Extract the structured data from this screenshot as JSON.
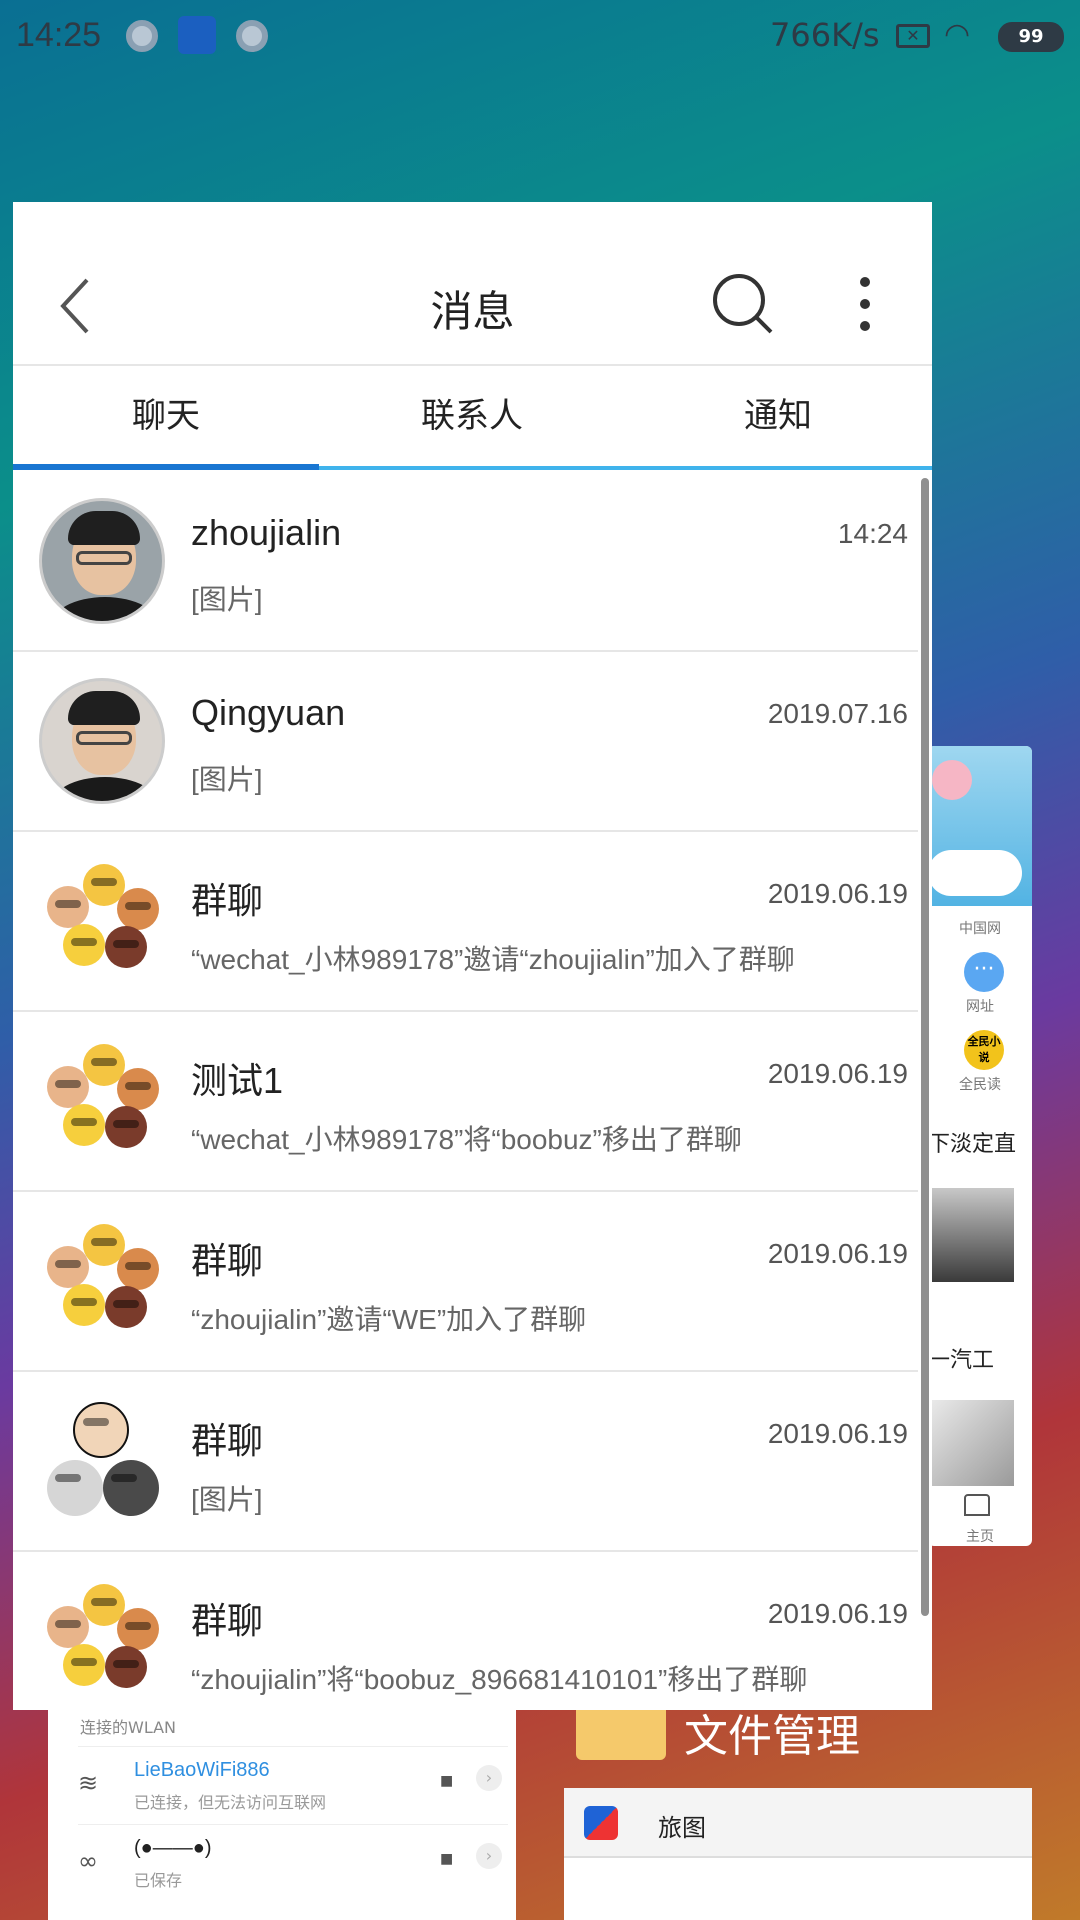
{
  "status_bar": {
    "time": "14:25",
    "speed": "766K/s",
    "battery": "99"
  },
  "app": {
    "title": "消息",
    "tabs": [
      {
        "label": "聊天",
        "active": true
      },
      {
        "label": "联系人",
        "active": false
      },
      {
        "label": "通知",
        "active": false
      }
    ]
  },
  "conversations": [
    {
      "name": "zhoujialin",
      "time": "14:24",
      "preview": "[图片]",
      "avatar": "photo"
    },
    {
      "name": "Qingyuan",
      "time": "2019.07.16",
      "preview": "[图片]",
      "avatar": "photo"
    },
    {
      "name": "群聊",
      "time": "2019.06.19",
      "preview": "“wechat_小林989178”邀请“zhoujialin”加入了群聊",
      "avatar": "group"
    },
    {
      "name": "测试1",
      "time": "2019.06.19",
      "preview": "“wechat_小林989178”将“boobuz”移出了群聊",
      "avatar": "group"
    },
    {
      "name": "群聊",
      "time": "2019.06.19",
      "preview": "“zhoujialin”邀请“WE”加入了群聊",
      "avatar": "group"
    },
    {
      "name": "群聊",
      "time": "2019.06.19",
      "preview": "[图片]",
      "avatar": "group"
    },
    {
      "name": "群聊",
      "time": "2019.06.19",
      "preview": "“zhoujialin”将“boobuz_896681410101”移出了群聊",
      "avatar": "group"
    }
  ],
  "background": {
    "browser": {
      "small_top": "中国网",
      "url_label": "网址",
      "novel_badge": "全民小说",
      "novel_label": "全民读",
      "headline1": "下淡定直",
      "headline2": "一汽工",
      "home_label": "主页"
    },
    "wlan": {
      "header": "连接的WLAN",
      "networks": [
        {
          "name": "LieBaoWiFi886",
          "status": "已连接，但无法访问互联网"
        },
        {
          "name": "(●——●)",
          "status": "已保存"
        }
      ]
    },
    "file_manager_title": "文件管理",
    "tutu_title": "旅图"
  },
  "colors": {
    "tab_active": "#1976d2",
    "tab_line": "#3fb3ec",
    "wifi_link": "#2f8fe0"
  }
}
